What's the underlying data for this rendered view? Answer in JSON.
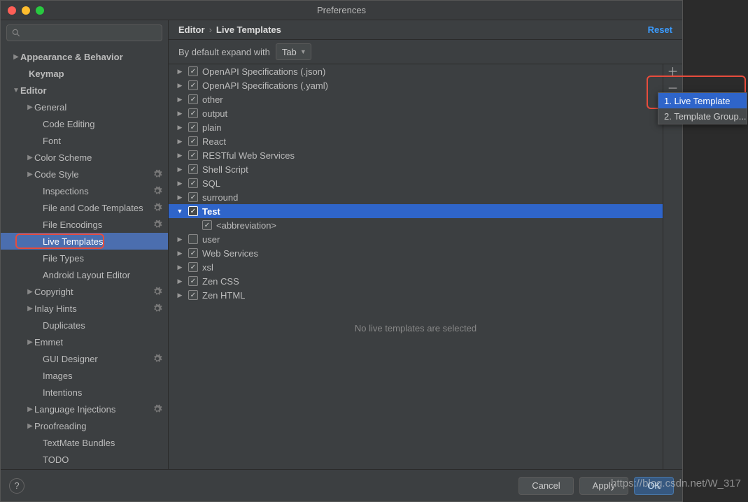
{
  "window": {
    "title": "Preferences"
  },
  "search": {
    "placeholder": ""
  },
  "sidebar": [
    {
      "label": "Appearance & Behavior",
      "arrow": "right",
      "indent": 16,
      "bold": true
    },
    {
      "label": "Keymap",
      "arrow": "",
      "indent": 28,
      "bold": true
    },
    {
      "label": "Editor",
      "arrow": "down",
      "indent": 16,
      "bold": true
    },
    {
      "label": "General",
      "arrow": "right",
      "indent": 36
    },
    {
      "label": "Code Editing",
      "arrow": "",
      "indent": 48
    },
    {
      "label": "Font",
      "arrow": "",
      "indent": 48
    },
    {
      "label": "Color Scheme",
      "arrow": "right",
      "indent": 36
    },
    {
      "label": "Code Style",
      "arrow": "right",
      "indent": 36,
      "gear": true
    },
    {
      "label": "Inspections",
      "arrow": "",
      "indent": 48,
      "gear": true
    },
    {
      "label": "File and Code Templates",
      "arrow": "",
      "indent": 48,
      "gear": true
    },
    {
      "label": "File Encodings",
      "arrow": "",
      "indent": 48,
      "gear": true
    },
    {
      "label": "Live Templates",
      "arrow": "",
      "indent": 48,
      "selected": true
    },
    {
      "label": "File Types",
      "arrow": "",
      "indent": 48
    },
    {
      "label": "Android Layout Editor",
      "arrow": "",
      "indent": 48
    },
    {
      "label": "Copyright",
      "arrow": "right",
      "indent": 36,
      "gear": true
    },
    {
      "label": "Inlay Hints",
      "arrow": "right",
      "indent": 36,
      "gear": true
    },
    {
      "label": "Duplicates",
      "arrow": "",
      "indent": 48
    },
    {
      "label": "Emmet",
      "arrow": "right",
      "indent": 36
    },
    {
      "label": "GUI Designer",
      "arrow": "",
      "indent": 48,
      "gear": true
    },
    {
      "label": "Images",
      "arrow": "",
      "indent": 48
    },
    {
      "label": "Intentions",
      "arrow": "",
      "indent": 48
    },
    {
      "label": "Language Injections",
      "arrow": "right",
      "indent": 36,
      "gear": true
    },
    {
      "label": "Proofreading",
      "arrow": "right",
      "indent": 36
    },
    {
      "label": "TextMate Bundles",
      "arrow": "",
      "indent": 48
    },
    {
      "label": "TODO",
      "arrow": "",
      "indent": 48
    }
  ],
  "breadcrumb": {
    "a": "Editor",
    "b": "Live Templates",
    "reset": "Reset"
  },
  "expand": {
    "label": "By default expand with",
    "value": "Tab"
  },
  "templates": [
    {
      "label": "OpenAPI Specifications (.json)",
      "indent": 10,
      "checked": true,
      "arrow": "r"
    },
    {
      "label": "OpenAPI Specifications (.yaml)",
      "indent": 10,
      "checked": true,
      "arrow": "r"
    },
    {
      "label": "other",
      "indent": 10,
      "checked": true,
      "arrow": "r"
    },
    {
      "label": "output",
      "indent": 10,
      "checked": true,
      "arrow": "r"
    },
    {
      "label": "plain",
      "indent": 10,
      "checked": true,
      "arrow": "r"
    },
    {
      "label": "React",
      "indent": 10,
      "checked": true,
      "arrow": "r"
    },
    {
      "label": "RESTful Web Services",
      "indent": 10,
      "checked": true,
      "arrow": "r"
    },
    {
      "label": "Shell Script",
      "indent": 10,
      "checked": true,
      "arrow": "r"
    },
    {
      "label": "SQL",
      "indent": 10,
      "checked": true,
      "arrow": "r"
    },
    {
      "label": "surround",
      "indent": 10,
      "checked": true,
      "arrow": "r"
    },
    {
      "label": "Test",
      "indent": 10,
      "checked": true,
      "arrow": "d",
      "selected": true,
      "bold": true
    },
    {
      "label": "<abbreviation>",
      "indent": 30,
      "checked": true,
      "arrow": ""
    },
    {
      "label": "user",
      "indent": 10,
      "checked": false,
      "arrow": "r"
    },
    {
      "label": "Web Services",
      "indent": 10,
      "checked": true,
      "arrow": "r"
    },
    {
      "label": "xsl",
      "indent": 10,
      "checked": true,
      "arrow": "r"
    },
    {
      "label": "Zen CSS",
      "indent": 10,
      "checked": true,
      "arrow": "r"
    },
    {
      "label": "Zen HTML",
      "indent": 10,
      "checked": true,
      "arrow": "r"
    }
  ],
  "message": "No live templates are selected",
  "footer": {
    "cancel": "Cancel",
    "apply": "Apply",
    "ok": "OK"
  },
  "popup": {
    "opt1": "1. Live Template",
    "opt2": "2. Template Group..."
  },
  "watermark": "https://blog.csdn.net/W_317",
  "icons": {
    "plus": "＋",
    "minus": "－",
    "dup": "⧉",
    "undo": "↶"
  }
}
